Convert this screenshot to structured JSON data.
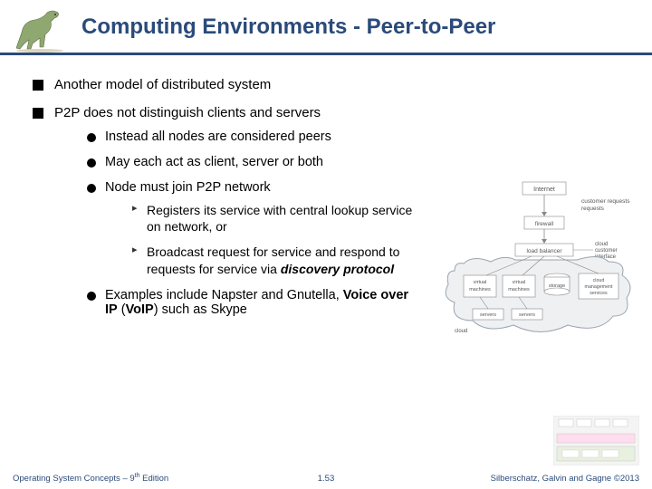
{
  "title": "Computing Environments - Peer-to-Peer",
  "bullets": {
    "b1": "Another model of distributed system",
    "b2": "P2P does not distinguish clients and servers",
    "b2_1": "Instead all nodes are considered peers",
    "b2_2": "May each act as client, server or both",
    "b2_3": "Node must join P2P network",
    "b2_3_1": "Registers its service with central lookup service on network, or",
    "b2_3_2a": "Broadcast request for service and respond to requests for service via ",
    "b2_3_2b": "discovery protocol",
    "b2_4a": "Examples include Napster and Gnutella, ",
    "b2_4b": "Voice over IP",
    "b2_4c": " (",
    "b2_4d": "VoIP",
    "b2_4e": ") such as Skype"
  },
  "diagram_labels": {
    "internet": "Internet",
    "custreq": "customer requests",
    "firewall": "firewall",
    "lb": "load balancer",
    "cloudif": "cloud customer interface",
    "vm1": "virtual machines",
    "vm2": "virtual machines",
    "storage": "storage",
    "mgmt": "cloud management services",
    "servers": "servers",
    "cloud": "cloud"
  },
  "footer": {
    "left_a": "Operating System Concepts – 9",
    "left_sup": "th",
    "left_b": " Edition",
    "center": "1.53",
    "right": "Silberschatz, Galvin and Gagne ©2013"
  }
}
